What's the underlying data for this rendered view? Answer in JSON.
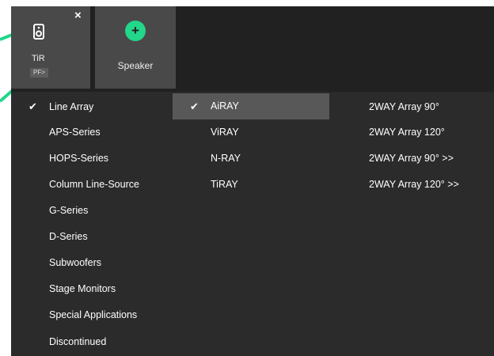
{
  "tiles": {
    "tir": {
      "label": "TiR",
      "badge": "PF>",
      "close": "×"
    },
    "add_speaker": {
      "label": "Speaker",
      "plus": "+"
    }
  },
  "accent_color": "#22d68a",
  "series": [
    {
      "label": "Line Array",
      "checked": true
    },
    {
      "label": "APS-Series"
    },
    {
      "label": "HOPS-Series"
    },
    {
      "label": "Column Line-Source"
    },
    {
      "label": "G-Series"
    },
    {
      "label": "D-Series"
    },
    {
      "label": "Subwoofers"
    },
    {
      "label": "Stage Monitors"
    },
    {
      "label": "Special Applications"
    },
    {
      "label": "Discontinued"
    }
  ],
  "models": [
    {
      "label": "AiRAY",
      "selected": true,
      "checked": true
    },
    {
      "label": "ViRAY"
    },
    {
      "label": "N-RAY"
    },
    {
      "label": "TiRAY"
    }
  ],
  "variants": [
    {
      "label": "2WAY Array 90°"
    },
    {
      "label": "2WAY Array 120°"
    },
    {
      "label": "2WAY Array 90° >>"
    },
    {
      "label": "2WAY Array 120° >>"
    }
  ],
  "check_glyph": "✔"
}
